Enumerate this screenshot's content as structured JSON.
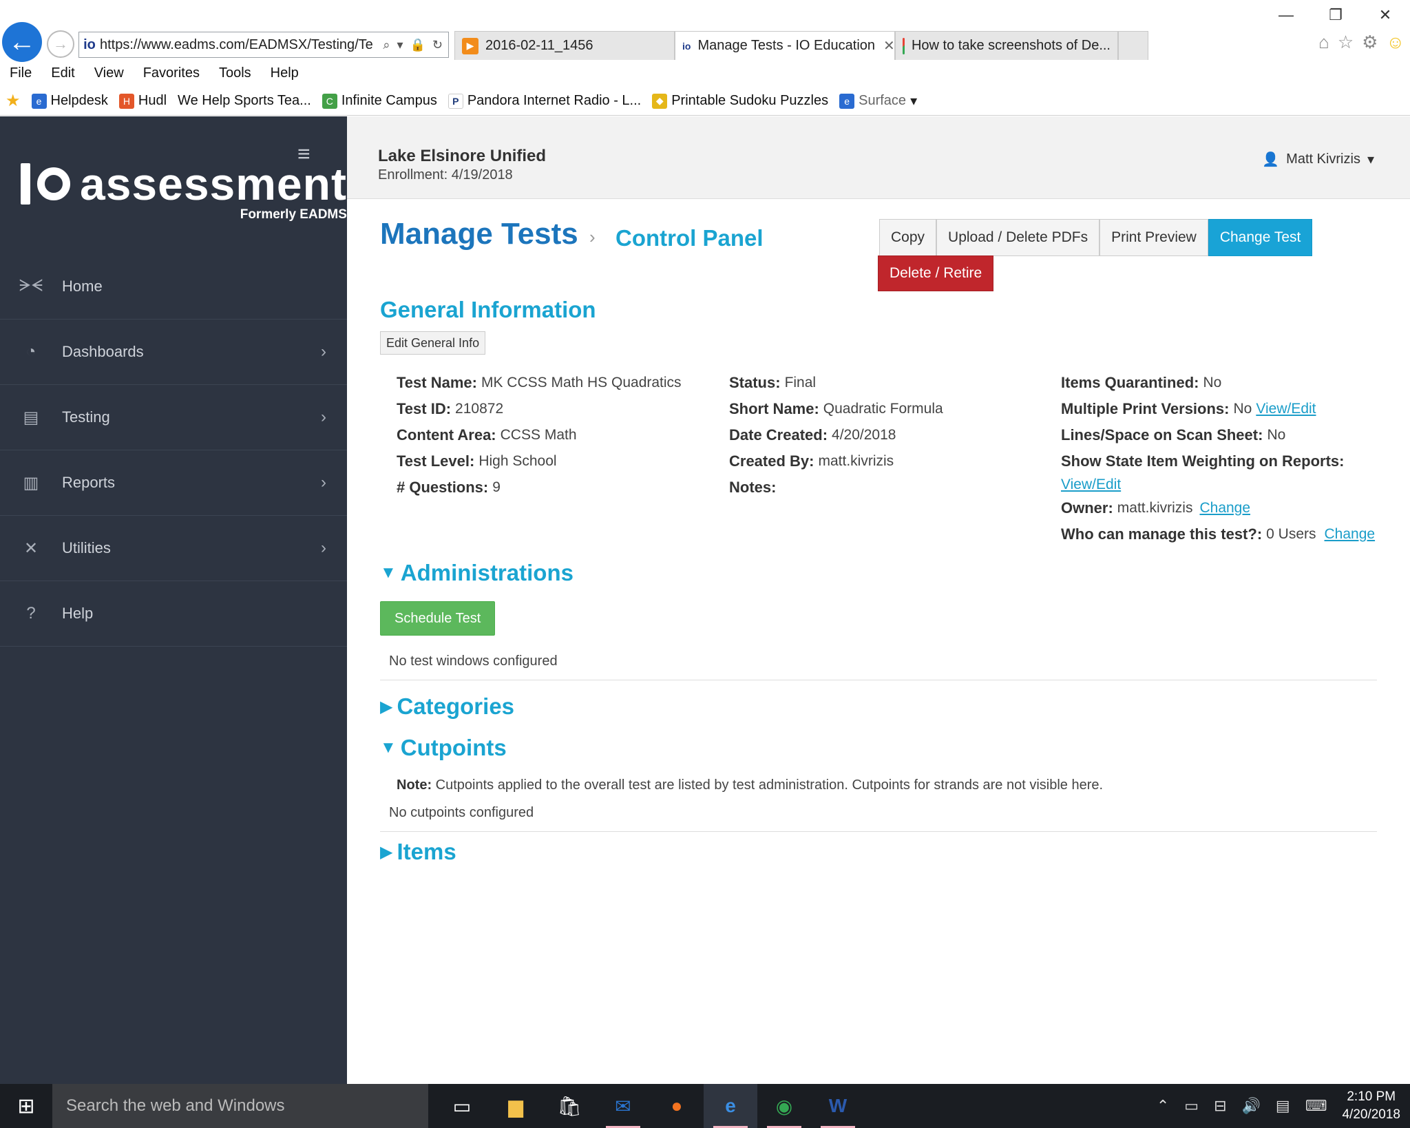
{
  "browser": {
    "url": "https://www.eadms.com/EADMSX/Testing/Te",
    "tabs": [
      {
        "label": "2016-02-11_1456",
        "active": false
      },
      {
        "label": "Manage Tests - IO Education",
        "active": true
      },
      {
        "label": "How to take screenshots of De...",
        "active": false
      }
    ],
    "menu": [
      "File",
      "Edit",
      "View",
      "Favorites",
      "Tools",
      "Help"
    ],
    "favorites": [
      "Helpdesk",
      "Hudl",
      "We Help Sports Tea...",
      "Infinite Campus",
      "Pandora Internet Radio - L...",
      "Printable Sudoku Puzzles",
      "Surface"
    ]
  },
  "sidebar": {
    "logo_text": "assessment",
    "logo_sub": "Formerly EADMS",
    "items": [
      {
        "label": "Home",
        "icon": "butterfly-icon",
        "has_chevron": false
      },
      {
        "label": "Dashboards",
        "icon": "dashboard-icon",
        "has_chevron": true
      },
      {
        "label": "Testing",
        "icon": "document-icon",
        "has_chevron": true
      },
      {
        "label": "Reports",
        "icon": "bar-chart-icon",
        "has_chevron": true
      },
      {
        "label": "Utilities",
        "icon": "tools-icon",
        "has_chevron": true
      },
      {
        "label": "Help",
        "icon": "question-icon",
        "has_chevron": false
      }
    ]
  },
  "header": {
    "district": "Lake Elsinore Unified",
    "enrollment": "Enrollment: 4/19/2018",
    "user": "Matt Kivrizis"
  },
  "page": {
    "title": "Manage Tests",
    "crumb": "Control Panel",
    "buttons": {
      "copy": "Copy",
      "upload": "Upload / Delete PDFs",
      "print": "Print Preview",
      "change": "Change Test",
      "delete": "Delete / Retire"
    }
  },
  "general": {
    "title": "General Information",
    "edit_label": "Edit General Info",
    "col1": [
      {
        "label": "Test Name:",
        "value": "MK CCSS Math HS Quadratics"
      },
      {
        "label": "Test ID:",
        "value": "210872"
      },
      {
        "label": "Content Area:",
        "value": "CCSS Math"
      },
      {
        "label": "Test Level:",
        "value": "High School"
      },
      {
        "label": "# Questions:",
        "value": "9"
      }
    ],
    "col2": [
      {
        "label": "Status:",
        "value": "Final"
      },
      {
        "label": "Short Name:",
        "value": "Quadratic Formula"
      },
      {
        "label": "Date Created:",
        "value": "4/20/2018"
      },
      {
        "label": "Created By:",
        "value": "matt.kivrizis"
      },
      {
        "label": "Notes:",
        "value": ""
      }
    ],
    "col3": {
      "items_quarantined_label": "Items Quarantined:",
      "items_quarantined_value": "No",
      "multi_print_label": "Multiple Print Versions:",
      "multi_print_value": "No",
      "multi_print_link": "View/Edit",
      "lines_space_label": "Lines/Space on Scan Sheet:",
      "lines_space_value": "No",
      "state_weight_label": "Show State Item Weighting on Reports:",
      "state_weight_link": "View/Edit",
      "owner_label": "Owner:",
      "owner_value": "matt.kivrizis",
      "owner_link": "Change",
      "who_label": "Who can manage this test?:",
      "who_value": "0 Users",
      "who_link": "Change"
    }
  },
  "administrations": {
    "title": "Administrations",
    "schedule_label": "Schedule Test",
    "empty_text": "No test windows configured"
  },
  "categories": {
    "title": "Categories"
  },
  "cutpoints": {
    "title": "Cutpoints",
    "note_label": "Note:",
    "note_text": "Cutpoints applied to the overall test are listed by test administration. Cutpoints for strands are not visible here.",
    "empty_text": "No cutpoints configured"
  },
  "items": {
    "title": "Items"
  },
  "taskbar": {
    "search_placeholder": "Search the web and Windows",
    "time": "2:10 PM",
    "date": "4/20/2018"
  }
}
